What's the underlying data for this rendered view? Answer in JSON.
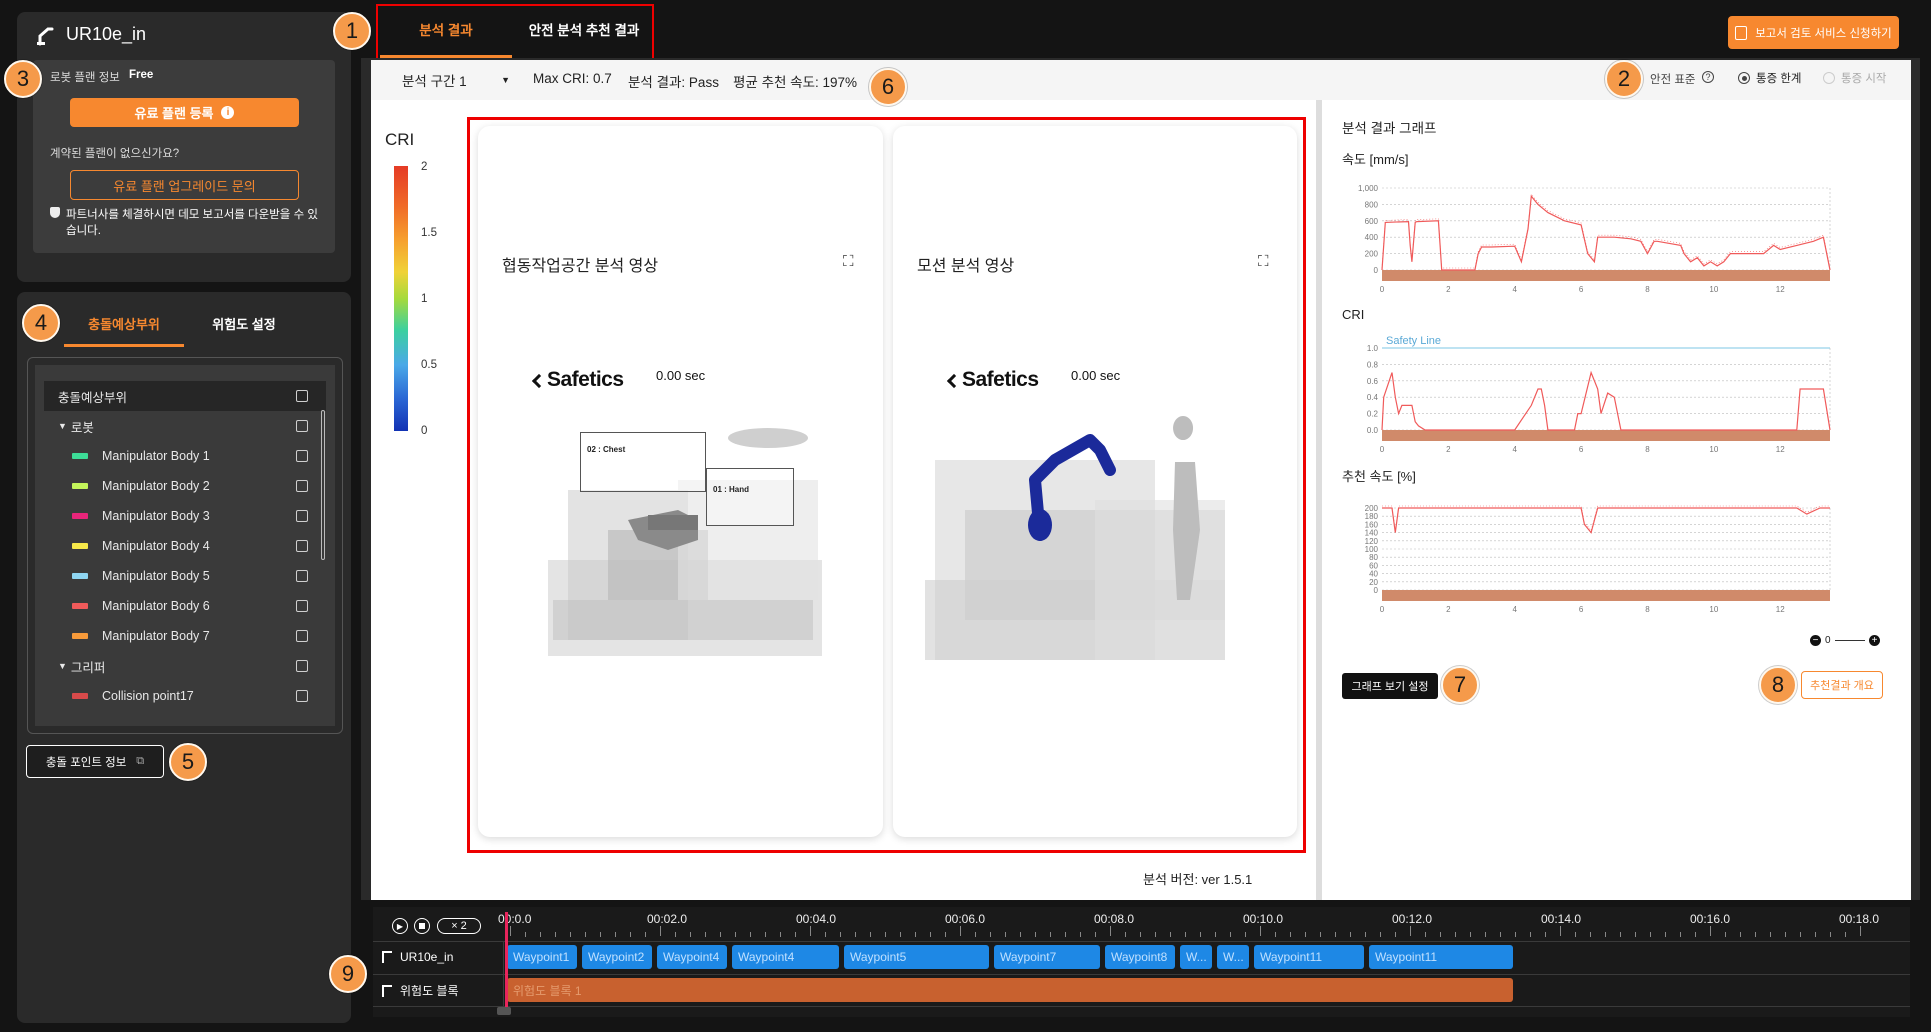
{
  "app": {
    "robot_name": "UR10e_in"
  },
  "badges": [
    "1",
    "2",
    "3",
    "4",
    "5",
    "6",
    "7",
    "8",
    "9"
  ],
  "plan": {
    "label": "로봇 플랜 정보",
    "value": "Free",
    "register_btn": "유료 플랜 등록",
    "no_plan_text": "계약된 플랜이 없으신가요?",
    "upgrade_btn": "유료 플랜 업그레이드 문의",
    "partner_note": "파트너사를 체결하시면 데모 보고서를 다운받을 수 있습니다."
  },
  "left_tabs": {
    "tab1": "충돌예상부위",
    "tab2": "위험도 설정"
  },
  "tree": {
    "header": "충돌예상부위",
    "robot_group": "로봇",
    "gripper_group": "그리퍼",
    "robot_items": [
      {
        "label": "Manipulator Body 1",
        "color": "#3ddc97"
      },
      {
        "label": "Manipulator Body 2",
        "color": "#c3f45a"
      },
      {
        "label": "Manipulator Body 3",
        "color": "#e8257a"
      },
      {
        "label": "Manipulator Body 4",
        "color": "#f7e94a"
      },
      {
        "label": "Manipulator Body 5",
        "color": "#8fd6f2"
      },
      {
        "label": "Manipulator Body 6",
        "color": "#f05a5a"
      },
      {
        "label": "Manipulator Body 7",
        "color": "#f79a3a"
      }
    ],
    "gripper_items": [
      {
        "label": "Collision point17",
        "color": "#d84a4a"
      }
    ]
  },
  "collision_btn": "충돌 포인트 정보",
  "top_tabs": {
    "tab1": "분석 결과",
    "tab2": "안전 분석 추천 결과"
  },
  "report_btn": "보고서 검토 서비스 신청하기",
  "info_bar": {
    "section": "분석 구간 1",
    "max_cri": "Max CRI: 0.7",
    "result": "분석 결과: Pass",
    "avg_speed": "평균 추천 속도: 197%",
    "standard_label": "안전 표준",
    "radio1": "통증 한계",
    "radio2": "통증 시작"
  },
  "cri_scale": {
    "title": "CRI",
    "ticks": [
      "2",
      "1.5",
      "1",
      "0.5",
      "0"
    ]
  },
  "videos": {
    "left_title": "협동작업공간 분석 영상",
    "right_title": "모션 분석 영상",
    "logo": "Safetics",
    "time": "0.00 sec",
    "box1": "02 : Chest",
    "box2": "01 : Hand"
  },
  "version": "분석 버전: ver 1.5.1",
  "graphs": {
    "title": "분석 결과 그래프",
    "speed_label": "속도 [mm/s]",
    "cri_label": "CRI",
    "rec_label": "추천 속도 [%]",
    "safety_line": "Safety Line",
    "speed_yticks": [
      "1,000",
      "800",
      "600",
      "400",
      "200",
      "0"
    ],
    "cri_yticks": [
      "1.0",
      "0.8",
      "0.6",
      "0.4",
      "0.2",
      "0.0"
    ],
    "rec_yticks": [
      "200",
      "180",
      "160",
      "140",
      "120",
      "100",
      "80",
      "60",
      "40",
      "20",
      "0"
    ],
    "xticks": [
      "0",
      "2",
      "4",
      "6",
      "8",
      "10",
      "12"
    ],
    "zoom_value": "0",
    "view_settings_btn": "그래프 보기 설정",
    "summary_btn": "추천결과 개요"
  },
  "chart_data": [
    {
      "type": "line",
      "title": "속도 [mm/s]",
      "xlim": [
        0,
        13.5
      ],
      "ylim": [
        0,
        1000
      ],
      "x": [
        0,
        0.1,
        0.8,
        0.85,
        0.9,
        1.0,
        1.05,
        1.7,
        1.75,
        1.8,
        2.0,
        2.8,
        2.9,
        3.0,
        3.3,
        4.0,
        4.2,
        4.4,
        4.5,
        4.7,
        5.0,
        5.5,
        6.0,
        6.2,
        6.4,
        6.5,
        7.0,
        7.5,
        7.8,
        8.0,
        8.2,
        8.3,
        9.0,
        9.1,
        9.2,
        9.3,
        9.5,
        9.7,
        9.9,
        10.1,
        10.3,
        10.5,
        11.0,
        11.5,
        11.8,
        12.0,
        12.5,
        13.0,
        13.3,
        13.5
      ],
      "y": [
        0,
        580,
        590,
        300,
        100,
        580,
        590,
        600,
        300,
        0,
        0,
        0,
        200,
        280,
        280,
        290,
        100,
        500,
        900,
        800,
        700,
        600,
        550,
        200,
        100,
        400,
        400,
        380,
        350,
        200,
        350,
        350,
        300,
        200,
        150,
        100,
        150,
        50,
        100,
        50,
        100,
        200,
        200,
        200,
        300,
        250,
        300,
        350,
        400,
        0
      ]
    },
    {
      "type": "line",
      "title": "CRI",
      "xlim": [
        0,
        13.5
      ],
      "ylim": [
        0,
        1.0
      ],
      "x": [
        0,
        0.05,
        0.3,
        0.4,
        0.5,
        0.6,
        0.9,
        1.0,
        1.1,
        1.3,
        2.0,
        4.0,
        4.5,
        4.7,
        4.8,
        4.9,
        5.0,
        5.8,
        5.9,
        6.0,
        6.3,
        6.5,
        6.6,
        6.8,
        7.0,
        7.2,
        12.5,
        12.6,
        13.3,
        13.5
      ],
      "y": [
        0,
        0.4,
        0.7,
        0.4,
        0.2,
        0.3,
        0.3,
        0.1,
        0.05,
        0,
        0,
        0,
        0.3,
        0.5,
        0.5,
        0.3,
        0,
        0,
        0.2,
        0.2,
        0.7,
        0.5,
        0.2,
        0.45,
        0.4,
        0,
        0,
        0.5,
        0.5,
        0
      ]
    },
    {
      "type": "line",
      "title": "추천 속도 [%]",
      "xlim": [
        0,
        13.5
      ],
      "ylim": [
        0,
        200
      ],
      "x": [
        0,
        0.3,
        0.4,
        0.5,
        6.0,
        6.1,
        6.3,
        6.5,
        6.6,
        12.5,
        12.8,
        13.2,
        13.5
      ],
      "y": [
        200,
        200,
        140,
        200,
        200,
        160,
        140,
        200,
        200,
        200,
        185,
        200,
        200
      ],
      "series": [
        {
          "name": "Safety Line",
          "values": [
            1.0
          ]
        }
      ]
    }
  ],
  "timeline": {
    "speed": "× 2",
    "ticks": [
      "00:0.0",
      "00:02.0",
      "00:04.0",
      "00:06.0",
      "00:08.0",
      "00:10.0",
      "00:12.0",
      "00:14.0",
      "00:16.0",
      "00:18.0"
    ],
    "track1": "UR10e_in",
    "track2": "위험도 블록",
    "waypoints": [
      "Waypoint1",
      "Waypoint2",
      "Waypoint4",
      "Waypoint4",
      "Waypoint5",
      "Waypoint7",
      "Waypoint8",
      "W...",
      "W...",
      "Waypoint11",
      "Waypoint11"
    ],
    "risk_block": "위험도 블록 1"
  }
}
